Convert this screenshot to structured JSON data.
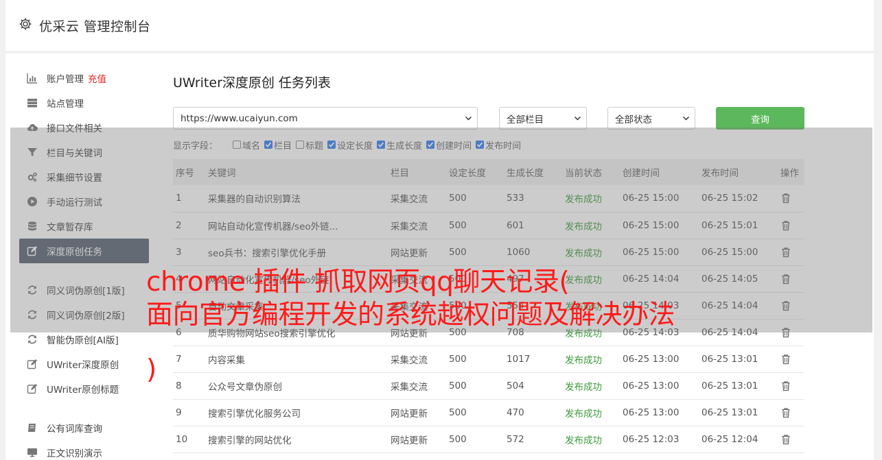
{
  "header": {
    "title": "优采云 管理控制台"
  },
  "sidebar": {
    "group1": [
      {
        "label": "账户管理",
        "icon": "bar-chart-icon",
        "extra": "充值"
      },
      {
        "label": "站点管理",
        "icon": "server-icon"
      },
      {
        "label": "接口文件相关",
        "icon": "cloud-upload-icon"
      },
      {
        "label": "栏目与关键词",
        "icon": "filter-icon"
      },
      {
        "label": "采集细节设置",
        "icon": "gears-icon"
      },
      {
        "label": "手动运行测试",
        "icon": "play-circle-icon"
      },
      {
        "label": "文章暂存库",
        "icon": "database-icon"
      },
      {
        "label": "深度原创任务",
        "icon": "edit-icon",
        "active": true
      }
    ],
    "group2": [
      {
        "label": "同义词伪原创[1版]",
        "icon": "refresh-icon"
      },
      {
        "label": "同义词伪原创[2版]",
        "icon": "refresh-icon"
      },
      {
        "label": "智能伪原创[AI版]",
        "icon": "refresh-icon"
      },
      {
        "label": "UWriter深度原创",
        "icon": "edit-icon"
      },
      {
        "label": "UWriter原创标题",
        "icon": "edit-icon"
      }
    ],
    "group3": [
      {
        "label": "公有词库查询",
        "icon": "book-icon"
      },
      {
        "label": "正文识别演示",
        "icon": "monitor-icon"
      }
    ]
  },
  "main": {
    "title": "UWriter深度原创 任务列表",
    "site_select": "https://www.ucaiyun.com",
    "column_select": "全部栏目",
    "status_select": "全部状态",
    "query_button": "查询",
    "fields_label": "显示字段：",
    "fields": [
      {
        "label": "域名",
        "checked": false
      },
      {
        "label": "栏目",
        "checked": true
      },
      {
        "label": "标题",
        "checked": false
      },
      {
        "label": "设定长度",
        "checked": true
      },
      {
        "label": "生成长度",
        "checked": true
      },
      {
        "label": "创建时间",
        "checked": true
      },
      {
        "label": "发布时间",
        "checked": true
      }
    ],
    "table": {
      "headers": [
        "序号",
        "关键词",
        "栏目",
        "设定长度",
        "生成长度",
        "当前状态",
        "创建时间",
        "发布时间",
        "操作"
      ],
      "rows": [
        [
          "1",
          "采集器的自动识别算法",
          "采集交流",
          "500",
          "533",
          "发布成功",
          "06-25 15:00",
          "06-25 15:02"
        ],
        [
          "2",
          "网站自动化宣传机器/seo外链...",
          "采集交流",
          "500",
          "601",
          "发布成功",
          "06-25 15:00",
          "06-25 15:01"
        ],
        [
          "3",
          "seo兵书：搜索引擎优化手册",
          "网站更新",
          "500",
          "1060",
          "发布成功",
          "06-25 15:00",
          "06-25 15:00"
        ],
        [
          "4",
          "网站自动化宣传机器/seo外链",
          "采集交流",
          "500",
          "497",
          "发布成功",
          "06-25 14:04",
          "06-25 14:05"
        ],
        [
          "5",
          "自动文章采集",
          "采集交流",
          "500",
          "554",
          "发布成功",
          "06-25 14:03",
          "06-25 14:04"
        ],
        [
          "6",
          "质华购物网站seo搜索引擎优化",
          "网站更新",
          "500",
          "708",
          "发布成功",
          "06-25 14:03",
          "06-25 14:04"
        ],
        [
          "7",
          "内容采集",
          "采集交流",
          "500",
          "1017",
          "发布成功",
          "06-25 13:00",
          "06-25 13:01"
        ],
        [
          "8",
          "公众号文章伪原创",
          "采集交流",
          "500",
          "504",
          "发布成功",
          "06-25 13:00",
          "06-25 13:01"
        ],
        [
          "9",
          "搜索引擎优化服务公司",
          "网站更新",
          "500",
          "470",
          "发布成功",
          "06-25 13:00",
          "06-25 13:01"
        ],
        [
          "10",
          "搜索引擎的网站优化",
          "网站更新",
          "500",
          "572",
          "发布成功",
          "06-25 12:03",
          "06-25 12:04"
        ]
      ]
    }
  },
  "overlay": {
    "line1": "chrome 插件 抓取网页qq聊天记录(",
    "line2": "面向官方编程开发的系统越权问题及解决办法",
    "line3": ")"
  },
  "colors": {
    "active_nav": "#586171",
    "query_button": "#5cb85c",
    "success": "#3c9a3c",
    "overlay_text": "#ff1a1a",
    "recharge": "#e02020"
  }
}
